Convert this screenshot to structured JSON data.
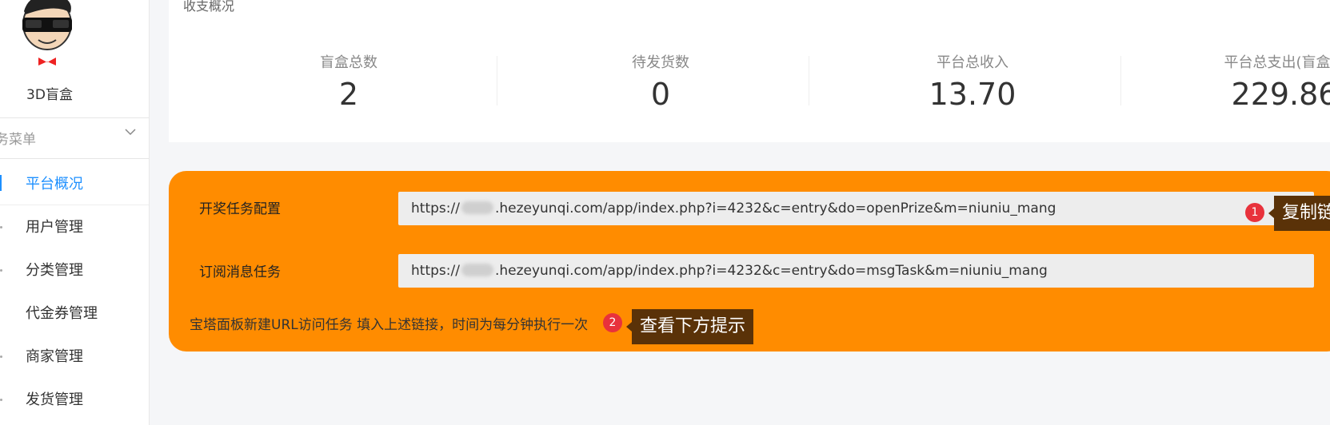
{
  "sidebar": {
    "app_name": "3D盲盒",
    "menu_header": "务菜单",
    "items": [
      {
        "label": "平台概况",
        "active": true
      },
      {
        "label": "用户管理"
      },
      {
        "label": "分类管理"
      },
      {
        "label": "代金券管理"
      },
      {
        "label": "商家管理"
      },
      {
        "label": "发货管理"
      }
    ]
  },
  "stats": {
    "title": "收支概况",
    "items": [
      {
        "label": "盲盒总数",
        "value": "2"
      },
      {
        "label": "待发货数",
        "value": "0"
      },
      {
        "label": "平台总收入",
        "value": "13.70"
      },
      {
        "label": "平台总支出(盲盒回",
        "value": "229.86"
      }
    ]
  },
  "task_panel": {
    "rows": [
      {
        "label": "开奖任务配置",
        "url_prefix": "https://",
        "url_suffix": ".hezeyunqi.com/app/index.php?i=4232&c=entry&do=openPrize&m=niuniu_mang"
      },
      {
        "label": "订阅消息任务",
        "url_prefix": "https://",
        "url_suffix": ".hezeyunqi.com/app/index.php?i=4232&c=entry&do=msgTask&m=niuniu_mang"
      }
    ],
    "hint": "宝塔面板新建URL访问任务 填入上述链接，时间为每分钟执行一次",
    "badge1": "1",
    "tip1": "复制链接",
    "badge2": "2",
    "tip2": "查看下方提示"
  },
  "colors": {
    "accent": "#1e90ff",
    "panel": "#ff8c00",
    "badge": "#e8323c",
    "tip_bg": "#5a3208"
  }
}
